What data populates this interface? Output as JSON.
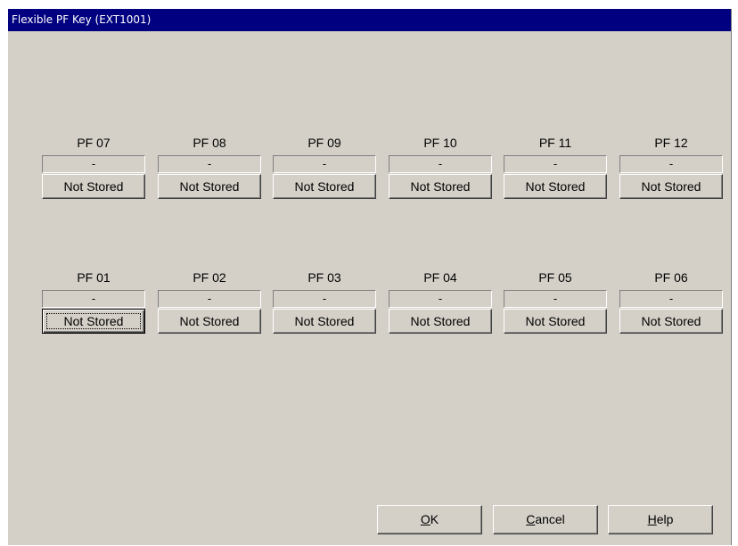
{
  "window": {
    "title": "Flexible PF Key (EXT1001)"
  },
  "top_row": [
    {
      "label": "PF 07",
      "value": "-",
      "button": "Not Stored"
    },
    {
      "label": "PF 08",
      "value": "-",
      "button": "Not Stored"
    },
    {
      "label": "PF 09",
      "value": "-",
      "button": "Not Stored"
    },
    {
      "label": "PF 10",
      "value": "-",
      "button": "Not Stored"
    },
    {
      "label": "PF 11",
      "value": "-",
      "button": "Not Stored"
    },
    {
      "label": "PF 12",
      "value": "-",
      "button": "Not Stored"
    }
  ],
  "bottom_row": [
    {
      "label": "PF 01",
      "value": "-",
      "button": "Not Stored"
    },
    {
      "label": "PF 02",
      "value": "-",
      "button": "Not Stored"
    },
    {
      "label": "PF 03",
      "value": "-",
      "button": "Not Stored"
    },
    {
      "label": "PF 04",
      "value": "-",
      "button": "Not Stored"
    },
    {
      "label": "PF 05",
      "value": "-",
      "button": "Not Stored"
    },
    {
      "label": "PF 06",
      "value": "-",
      "button": "Not Stored"
    }
  ],
  "dialog_buttons": {
    "ok": {
      "mnemonic": "O",
      "rest": "K"
    },
    "cancel": {
      "mnemonic": "C",
      "rest": "ancel"
    },
    "help": {
      "mnemonic": "H",
      "rest": "elp"
    }
  },
  "colors": {
    "face": "#d4d0c8",
    "titlebar": "#000080"
  }
}
